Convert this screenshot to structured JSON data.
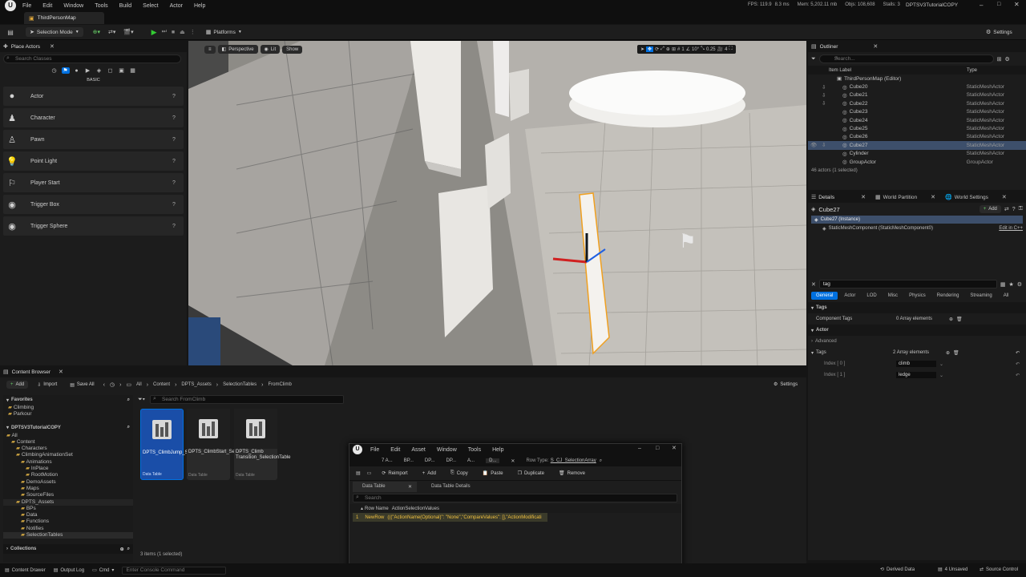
{
  "menubar": {
    "items": [
      "File",
      "Edit",
      "Window",
      "Tools",
      "Build",
      "Select",
      "Actor",
      "Help"
    ],
    "fps": "FPS: 119.9",
    "ms": "8.3 ms",
    "mem": "Mem: 5,202.11 mb",
    "objs": "Objs: 108,608",
    "stalls": "Stalls: 3",
    "project": "DPTSV3TutorialCOPY"
  },
  "level_tab": "ThirdPersonMap",
  "toolbar": {
    "selection_mode": "Selection Mode",
    "platforms": "Platforms",
    "settings": "Settings"
  },
  "place_actors": {
    "title": "Place Actors",
    "search_placeholder": "Search Classes",
    "category": "BASIC",
    "items": [
      "Actor",
      "Character",
      "Pawn",
      "Point Light",
      "Player Start",
      "Trigger Box",
      "Trigger Sphere"
    ]
  },
  "viewport": {
    "perspective": "Perspective",
    "lit": "Lit",
    "show": "Show",
    "angle": "10°",
    "scale": "0.25",
    "camera_speed": "4",
    "grid": "1"
  },
  "outliner": {
    "title": "Outliner",
    "search_placeholder": "Search...",
    "col_label": "Item Label",
    "col_type": "Type",
    "root": "ThirdPersonMap (Editor)",
    "rows": [
      {
        "name": "Cube20",
        "type": "StaticMeshActor"
      },
      {
        "name": "Cube21",
        "type": "StaticMeshActor"
      },
      {
        "name": "Cube22",
        "type": "StaticMeshActor"
      },
      {
        "name": "Cube23",
        "type": "StaticMeshActor"
      },
      {
        "name": "Cube24",
        "type": "StaticMeshActor"
      },
      {
        "name": "Cube25",
        "type": "StaticMeshActor"
      },
      {
        "name": "Cube26",
        "type": "StaticMeshActor"
      },
      {
        "name": "Cube27",
        "type": "StaticMeshActor"
      },
      {
        "name": "Cylinder",
        "type": "StaticMeshActor"
      },
      {
        "name": "GroupActor",
        "type": "GroupActor"
      }
    ],
    "count": "46 actors (1 selected)"
  },
  "details": {
    "tabs": [
      "Details",
      "World Partition",
      "World Settings"
    ],
    "actor_name": "Cube27",
    "add": "Add",
    "instance": "Cube27 (Instance)",
    "component": "StaticMeshComponent (StaticMeshComponent0)",
    "edit_cpp": "Edit in C++",
    "search_value": "tag",
    "categories": [
      "General",
      "Actor",
      "LOD",
      "Misc",
      "Physics",
      "Rendering",
      "Streaming",
      "All"
    ],
    "section_tags": "Tags",
    "component_tags": "Component Tags",
    "component_tags_value": "0 Array elements",
    "section_actor": "Actor",
    "advanced": "Advanced",
    "tags_label": "Tags",
    "tags_value": "2 Array elements",
    "index0": "Index [ 0 ]",
    "index0_value": "climb",
    "index1": "Index [ 1 ]",
    "index1_value": "ledge"
  },
  "content_browser": {
    "title": "Content Browser",
    "add": "Add",
    "import": "Import",
    "save_all": "Save All",
    "path": [
      "All",
      "Content",
      "DPTS_Assets",
      "SelectionTables",
      "FromClimb"
    ],
    "settings": "Settings",
    "search_placeholder": "Search FromClimb",
    "favorites": "Favorites",
    "fav_items": [
      "Climbing",
      "Parkour"
    ],
    "project": "DPTSV3TutorialCOPY",
    "tree": [
      "All",
      "Content",
      "Characters",
      "ClimbingAnimationSet",
      "Animations",
      "InPlace",
      "RootMotion",
      "DemoAssets",
      "Maps",
      "SourceFiles",
      "DPTS_Assets",
      "BPs",
      "Data",
      "Functions",
      "Notifies",
      "SelectionTables"
    ],
    "collections": "Collections",
    "assets": [
      {
        "name": "DPTS_ClimbJump_SelectionTable",
        "type": "Data Table"
      },
      {
        "name": "DPTS_ClimbStart_SelectionTable",
        "type": "Data Table"
      },
      {
        "name": "DPTS_Climb Transition_SelectionTable",
        "type": "Data Table"
      }
    ],
    "status": "3 items (1 selected)"
  },
  "data_table_window": {
    "menu": [
      "File",
      "Edit",
      "Asset",
      "Window",
      "Tools",
      "Help"
    ],
    "tabs": [
      "7 A...",
      "BP...",
      "DP...",
      "DP...",
      "A...",
      "D..."
    ],
    "row_type_label": "Row Type:",
    "row_type": "S_CJ_SelectionArray",
    "toolbar": [
      "Reimport",
      "Add",
      "Copy",
      "Paste",
      "Duplicate",
      "Remove"
    ],
    "panel_tabs": [
      "Data Table",
      "Data Table Details"
    ],
    "search_placeholder": "Search",
    "col_row_name": "Row Name",
    "col_values": "ActionSelectionValues",
    "row_index": "1",
    "row_name": "NewRow",
    "row_value": "(((\"ActionName(Optional)\": \"None\",\"CompareValues\": [],\"ActionModificati"
  },
  "statusbar": {
    "content_drawer": "Content Drawer",
    "output_log": "Output Log",
    "cmd": "Cmd",
    "console_placeholder": "Enter Console Command",
    "derived_data": "Derived Data",
    "unsaved": "4 Unsaved",
    "source_control": "Source Control"
  },
  "colors": {
    "accent": "#0070e0",
    "selection": "#3d4f6b",
    "highlight_orange": "#f0a020"
  }
}
